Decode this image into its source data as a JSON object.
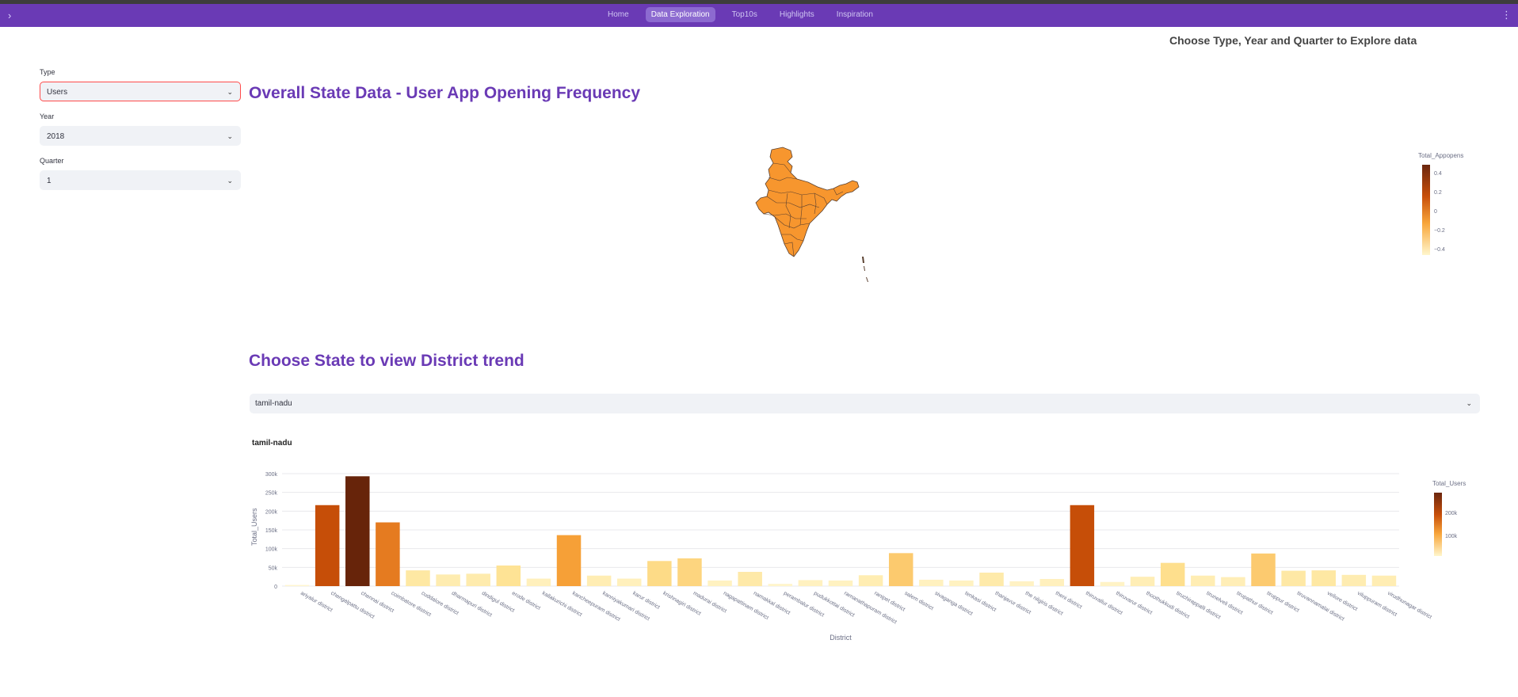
{
  "nav": {
    "expander_icon": "chevron-right-icon",
    "more_icon": "kebab-menu-icon",
    "items": [
      {
        "label": "Home",
        "active": false
      },
      {
        "label": "Data Exploration",
        "active": true
      },
      {
        "label": "Top10s",
        "active": false
      },
      {
        "label": "Highlights",
        "active": false
      },
      {
        "label": "Inspiration",
        "active": false
      }
    ]
  },
  "page_hint": "Choose Type, Year and Quarter to Explore data",
  "sidebar": {
    "type_label": "Type",
    "type_value": "Users",
    "year_label": "Year",
    "year_value": "2018",
    "quarter_label": "Quarter",
    "quarter_value": "1"
  },
  "map_section": {
    "title": "Overall State Data - User App Opening Frequency",
    "colorbar_title": "Total_Appopens",
    "colorbar_ticks": [
      "0.4",
      "0.2",
      "0",
      "−0.2",
      "−0.4"
    ],
    "fill_color": "#f7962e"
  },
  "district_section": {
    "title": "Choose State to view District trend",
    "state_value": "tamil-nadu"
  },
  "colors": {
    "accent": "#6a3ab5",
    "nav_bg": "#6a3ab5",
    "focus_border": "#ff4b4b"
  },
  "chart_data": {
    "type": "bar",
    "title": "tamil-nadu",
    "xlabel": "District",
    "ylabel": "Total_Users",
    "ylim": [
      0,
      300000
    ],
    "yticks": [
      "0",
      "50k",
      "100k",
      "150k",
      "200k",
      "250k",
      "300k"
    ],
    "grid": true,
    "colorbar_title": "Total_Users",
    "colorbar_ticks": [
      "200k",
      "100k"
    ],
    "categories": [
      "ariyalur district",
      "chengalpattu district",
      "chennai district",
      "coimbatore district",
      "cuddalore district",
      "dharmapuri district",
      "dindigul district",
      "erode district",
      "kallakurichi district",
      "kancheepuram district",
      "kanniyakumari district",
      "karur district",
      "krishnagiri district",
      "madurai district",
      "nagapattinam district",
      "namakkal district",
      "perambalur district",
      "pudukkottai district",
      "ramanathapuram district",
      "ranipet district",
      "salem district",
      "sivaganga district",
      "tenkasi district",
      "thanjavur district",
      "the nilgiris district",
      "theni district",
      "thiruvallur district",
      "thiruvarur district",
      "thoothukkudi district",
      "tiruchirappalli district",
      "tirunelveli district",
      "tirupathur district",
      "tiruppur district",
      "tiruvannamalai district",
      "vellore district",
      "viluppuram district",
      "virudhunagar district"
    ],
    "values": [
      3000,
      216000,
      293000,
      170000,
      42000,
      31000,
      33000,
      55000,
      20000,
      136000,
      28000,
      20000,
      67000,
      74000,
      15000,
      38000,
      6000,
      16000,
      15000,
      29000,
      88000,
      17000,
      15000,
      36000,
      13000,
      19000,
      216000,
      11000,
      25000,
      62000,
      28000,
      24000,
      87000,
      41000,
      42000,
      30000,
      28000
    ]
  }
}
